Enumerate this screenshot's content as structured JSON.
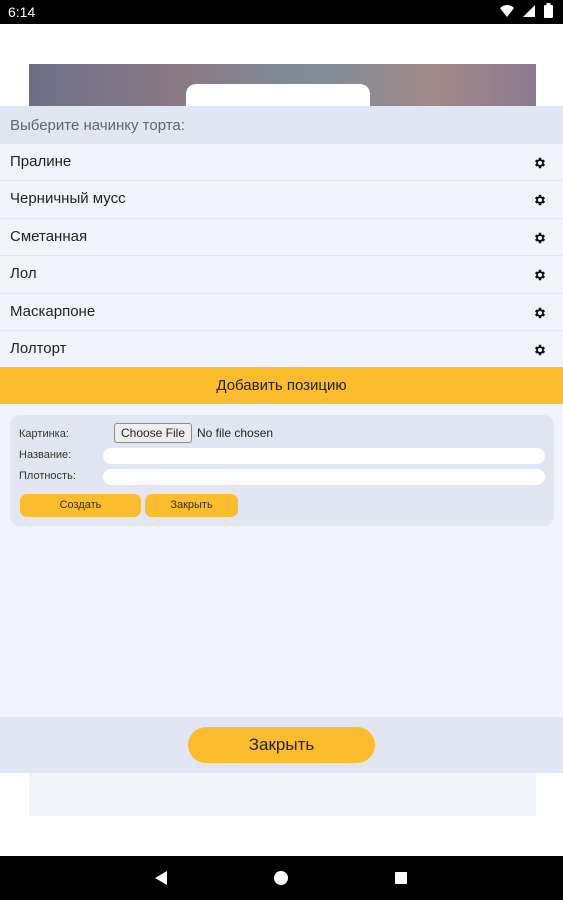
{
  "status_bar": {
    "time": "6:14"
  },
  "sheet": {
    "title": "Выберите начинку торта:",
    "items": [
      {
        "label": "Пралине"
      },
      {
        "label": "Черничный мусс"
      },
      {
        "label": "Сметанная"
      },
      {
        "label": "Лол"
      },
      {
        "label": "Маскарпоне"
      },
      {
        "label": "Лолторт"
      }
    ],
    "add_button": "Добавить позицию",
    "close_button": "Закрыть"
  },
  "form": {
    "picture_label": "Картинка:",
    "choose_file": "Choose File",
    "file_status": "No file chosen",
    "name_label": "Название:",
    "name_value": "",
    "density_label": "Плотность:",
    "density_value": "",
    "create_button": "Создать",
    "close_button": "Закрыть"
  },
  "colors": {
    "accent": "#fbbd2d",
    "sheet_bg": "#f1f3fc",
    "header_bg": "#e2e6f2"
  },
  "icons": {
    "item_action": "gear-icon",
    "nav": [
      "back-icon",
      "home-icon",
      "recents-icon"
    ],
    "status": [
      "wifi-icon",
      "signal-icon",
      "battery-icon"
    ]
  }
}
